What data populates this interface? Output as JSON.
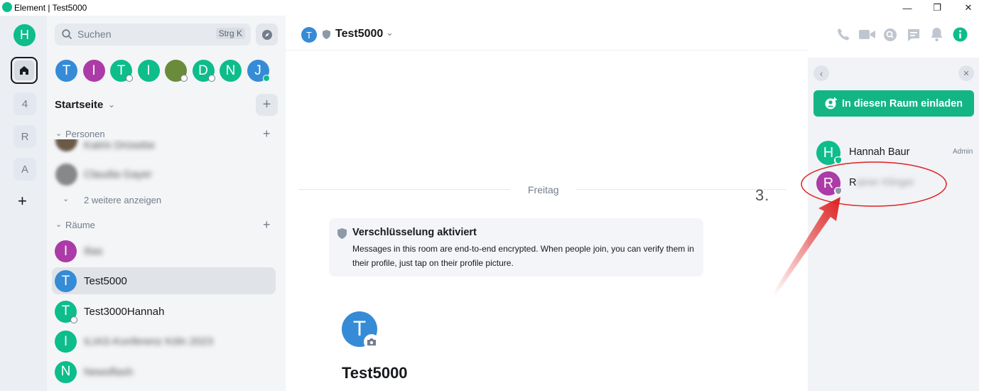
{
  "window": {
    "title": "Element | Test5000",
    "minimize": "—",
    "restore": "❐",
    "close": "✕"
  },
  "spaces": {
    "user_initial": "H",
    "items": [
      "4",
      "R",
      "A"
    ],
    "add": "+"
  },
  "search": {
    "placeholder": "Suchen",
    "shortcut": "Strg K"
  },
  "people_row": [
    {
      "initial": "T",
      "color": "#368bd6"
    },
    {
      "initial": "I",
      "color": "#ac3ba8"
    },
    {
      "initial": "T",
      "color": "#0dbd8b"
    },
    {
      "initial": "I",
      "color": "#0dbd8b"
    },
    {
      "initial": "",
      "color": "#6a8b3a"
    },
    {
      "initial": "D",
      "color": "#0dbd8b"
    },
    {
      "initial": "N",
      "color": "#0dbd8b"
    },
    {
      "initial": "J",
      "color": "#368bd6"
    }
  ],
  "home": {
    "title": "Startseite",
    "add": "+"
  },
  "sections": {
    "people": {
      "label": "Personen",
      "items": [
        "Katrin Drüsebe",
        "Claudia Gayer"
      ],
      "more": "2 weitere anzeigen"
    },
    "rooms": {
      "label": "Räume"
    }
  },
  "rooms": [
    {
      "initial": "I",
      "color": "#ac3ba8",
      "name": "Ilias",
      "blurred": true
    },
    {
      "initial": "T",
      "color": "#368bd6",
      "name": "Test5000",
      "blurred": false
    },
    {
      "initial": "T",
      "color": "#0dbd8b",
      "name": "Test3000Hannah",
      "blurred": false
    },
    {
      "initial": "I",
      "color": "#0dbd8b",
      "name": "ILIAS-Konferenz Köln 2023",
      "blurred": true
    },
    {
      "initial": "N",
      "color": "#0dbd8b",
      "name": "Newsflash",
      "blurred": true
    }
  ],
  "room_header": {
    "initial": "T",
    "name": "Test5000"
  },
  "timeline": {
    "date_separator": "Freitag",
    "encryption_title": "Verschlüsselung aktiviert",
    "encryption_body": "Messages in this room are end-to-end encrypted. When people join, you can verify them in their profile, just tap on their profile picture.",
    "room_intro_initial": "T",
    "room_intro_name": "Test5000"
  },
  "right_panel": {
    "invite_label": "In diesen Raum einladen",
    "members": [
      {
        "initial": "H",
        "color": "#0dbd8b",
        "name": "Hannah Baur",
        "role": "Admin"
      },
      {
        "initial": "R",
        "color": "#ac3ba8",
        "name_visible": "R",
        "name_blurred": "ainer Klinger",
        "role": ""
      }
    ]
  },
  "annotation": {
    "step_label": "3."
  },
  "colors": {
    "accent": "#0dbd8b",
    "annotation_red": "#e02020"
  }
}
